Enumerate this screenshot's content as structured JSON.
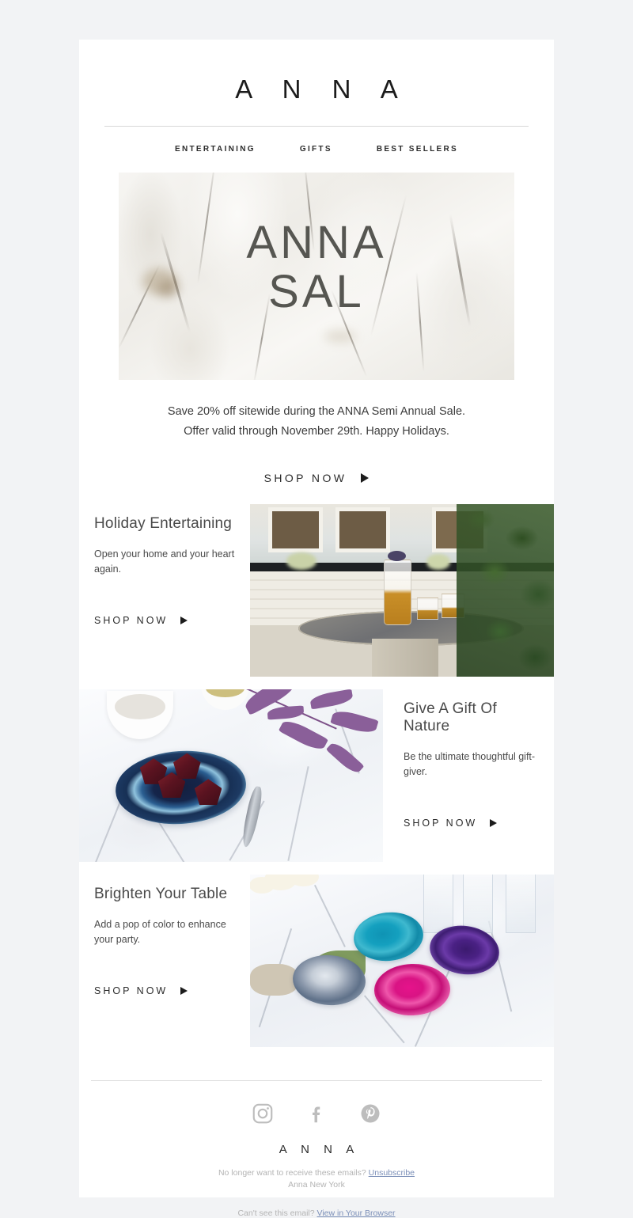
{
  "brand": {
    "logo": "A N N A",
    "footer_logo": "A N N A"
  },
  "nav": {
    "items": [
      {
        "label": "ENTERTAINING"
      },
      {
        "label": "GIFTS"
      },
      {
        "label": "BEST SELLERS"
      }
    ]
  },
  "hero": {
    "title": "ANNA\nSAL",
    "image_alt": "white-marble-texture",
    "title_color": "#565651"
  },
  "intro": {
    "text": "Save 20% off sitewide during the ANNA Semi Annual Sale.\nOffer valid through November 29th. Happy Holidays.",
    "cta_label": "SHOP NOW"
  },
  "sections": [
    {
      "title": "Holiday Entertaining",
      "subtitle": "Open your home and your heart again.",
      "cta_label": "SHOP NOW",
      "image_alt": "whiskey-decanter-on-patio-table",
      "image_side": "right"
    },
    {
      "title": "Give A Gift Of Nature",
      "subtitle": "Be the ultimate thoughtful gift-giver.",
      "cta_label": "SHOP NOW",
      "image_alt": "blue-agate-plate-with-chocolates",
      "image_side": "left"
    },
    {
      "title": "Brighten Your Table",
      "subtitle": "Add a pop of color to enhance your party.",
      "cta_label": "SHOP NOW",
      "image_alt": "colorful-agate-coasters-on-marble",
      "image_side": "right"
    }
  ],
  "footer": {
    "social": [
      {
        "name": "instagram-icon"
      },
      {
        "name": "facebook-icon"
      },
      {
        "name": "pinterest-icon"
      }
    ],
    "unsubscribe_prefix": "No longer want to receive these emails? ",
    "unsubscribe_link": "Unsubscribe",
    "address": "Anna New York",
    "browser_prefix": "Can't see this email? ",
    "browser_link": "View in Your Browser",
    "link_color": "#7b8fb8",
    "text_color": "#b4b4b4"
  }
}
